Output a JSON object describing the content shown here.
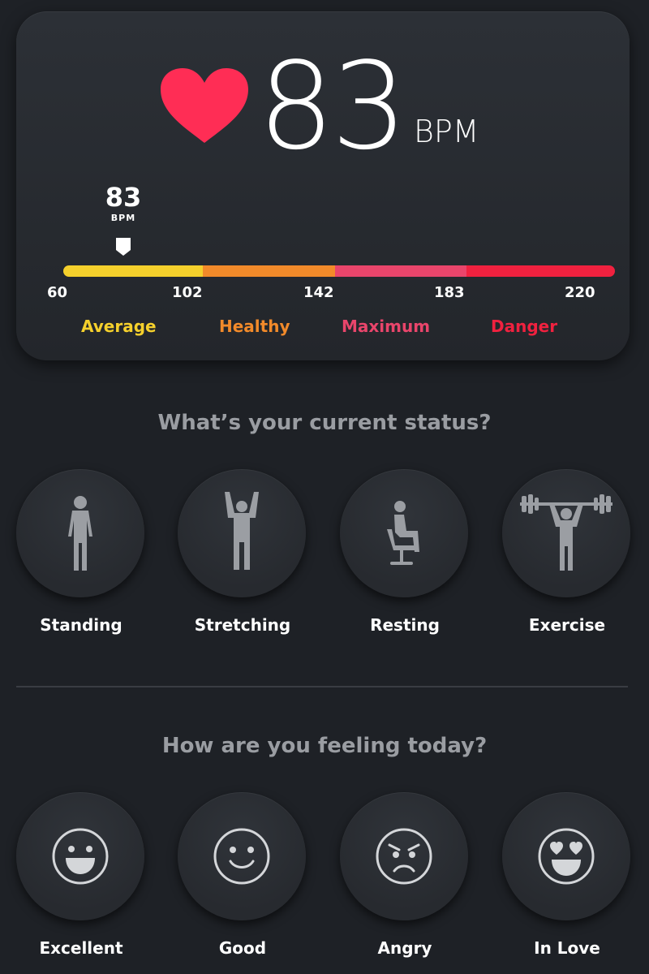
{
  "heart_rate": {
    "value": "83",
    "unit": "BPM",
    "marker_value": "83",
    "marker_unit": "BPM",
    "current_bpm": 83,
    "heart_color": "#ff2d55"
  },
  "range": {
    "ticks": [
      "60",
      "102",
      "142",
      "183",
      "220"
    ],
    "zones": [
      {
        "label": "Average",
        "color": "#f5d02c"
      },
      {
        "label": "Healthy",
        "color": "#f28a2a"
      },
      {
        "label": "Maximum",
        "color": "#e9456b"
      },
      {
        "label": "Danger",
        "color": "#f0213f"
      }
    ]
  },
  "status_section": {
    "title": "What’s your current status?",
    "options": [
      {
        "label": "Standing",
        "icon": "standing-person-icon"
      },
      {
        "label": "Stretching",
        "icon": "stretching-person-icon"
      },
      {
        "label": "Resting",
        "icon": "sitting-person-icon"
      },
      {
        "label": "Exercise",
        "icon": "weightlifting-person-icon"
      }
    ]
  },
  "feeling_section": {
    "title": "How are you feeling today?",
    "options": [
      {
        "label": "Excellent",
        "icon": "grinning-face-icon"
      },
      {
        "label": "Good",
        "icon": "smiling-face-icon"
      },
      {
        "label": "Angry",
        "icon": "angry-face-icon"
      },
      {
        "label": "In Love",
        "icon": "heart-eyes-face-icon"
      }
    ]
  }
}
